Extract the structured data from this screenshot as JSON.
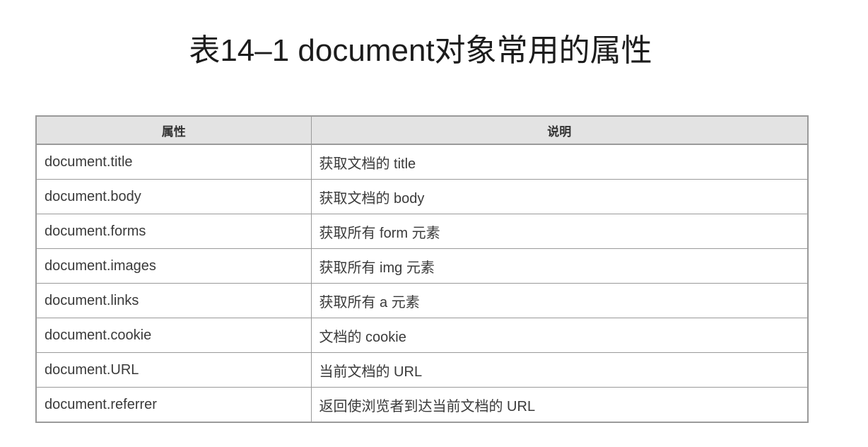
{
  "title": "表14–1 document对象常用的属性",
  "table": {
    "headers": [
      "属性",
      "说明"
    ],
    "rows": [
      [
        "document.title",
        "获取文档的 title"
      ],
      [
        "document.body",
        "获取文档的 body"
      ],
      [
        "document.forms",
        "获取所有 form 元素"
      ],
      [
        "document.images",
        "获取所有 img 元素"
      ],
      [
        "document.links",
        "获取所有 a 元素"
      ],
      [
        "document.cookie",
        "文档的 cookie"
      ],
      [
        "document.URL",
        "当前文档的 URL"
      ],
      [
        "document.referrer",
        "返回使浏览者到达当前文档的 URL"
      ]
    ]
  }
}
